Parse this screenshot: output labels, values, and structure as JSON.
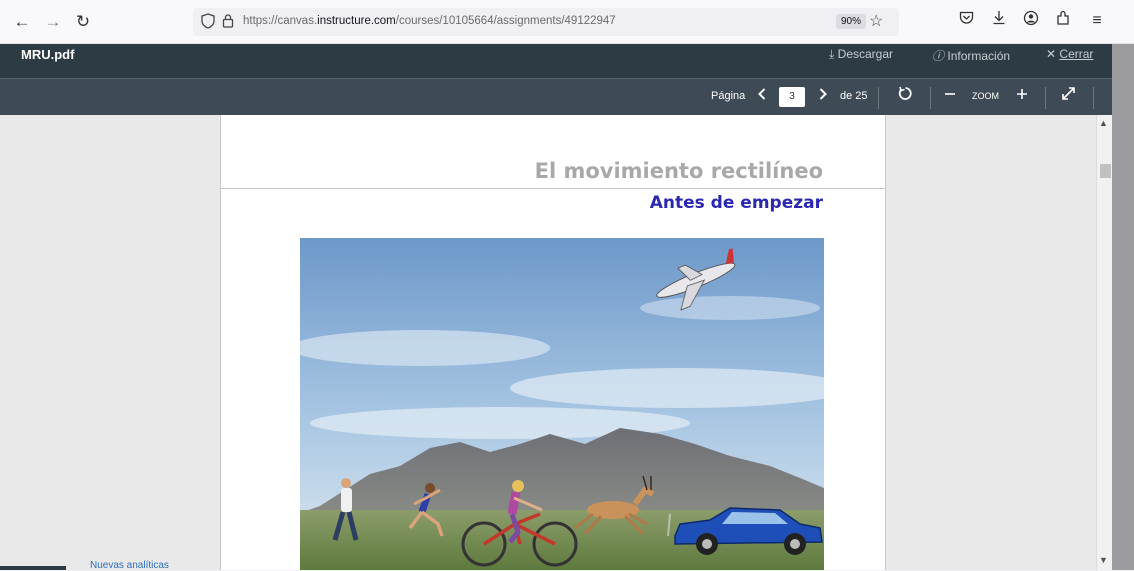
{
  "browser": {
    "url_prefix": "https://canvas.",
    "url_domain": "instructure.com",
    "url_path": "/courses/10105664/assignments/49122947",
    "zoom": "90%",
    "icons": [
      "back-icon",
      "forward-icon",
      "reload-icon",
      "shield-icon",
      "lock-icon",
      "bookmark-star-icon",
      "pocket-icon",
      "download-icon",
      "account-icon",
      "extensions-icon",
      "menu-icon"
    ]
  },
  "viewer": {
    "title": "MRU.pdf",
    "download_label": "Descargar",
    "info_label": "Información",
    "close_label": "Cerrar",
    "page_label": "Página",
    "current_page": "3",
    "total_pages": "de 25",
    "zoom_label": "ZOOM"
  },
  "document": {
    "heading": "El movimiento rectilíneo",
    "subheading": "Antes de empezar"
  },
  "footer": {
    "partial_text": "Nuevas analíticas"
  },
  "colors": {
    "viewer_header": "#2d3b45",
    "viewer_toolbar": "#3e4a55",
    "heading": "#a8a8a8",
    "subheading": "#2a28b0"
  }
}
